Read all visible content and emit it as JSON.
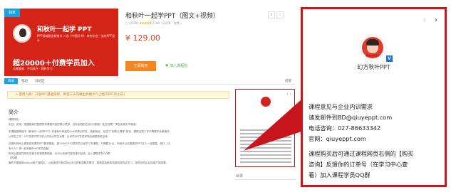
{
  "course": {
    "badge": "独家",
    "cover_brand": "和秋叶一起学 PPT",
    "cover_sub": "PPT领域最佳畅销书 入选《中国好书》 带你学会一流的PPT设计",
    "cover_count": "超20000＋付费学员加入",
    "cover_subcount": "无需基础 · 不用软件 · 随时学习",
    "title": "和秋叶一起学PPT（图文+视频）",
    "meta_prefix": "▢ 25306",
    "stars": "★★★★★",
    "meta_suffix": "2.3W · 好评率 · 收费 ✓",
    "price": "¥ 129.00",
    "buy_label": "立即购买",
    "fav_label": "♥ 加入课程包",
    "icon_share": "⇧",
    "icon_fav": "☆"
  },
  "tabs": {
    "items": [
      "目录",
      "笔记",
      "讨论区"
    ],
    "right": "问答"
  },
  "notice": "⚠ 使用人群：只会PPT基础操作，希望三天内做出高端大气上档次PPT的小白！",
  "intro": {
    "title": "简介",
    "lines": [
      "课程特色：",
      "实战，实用，快捷是我们整理所有课程内容的核心思想，还有全程的在线QQ答疑！还在犹豫？学起来其实不难哦！",
      "",
      "本课程是畅销书《和秋叶一起学PPT》作者秋叶和他的小伙伴原创开发，独家版权，完成了“网易云课堂”首页，跟踪这类工作中需要的全套操作。",
      "让你在工作，PPT变成不同于别人的亮点的艺术感，让你的PPT在任何场合都能惊艳全场。",
      "",
      "这是你的网上课堂的好看的PPT素材模板，超20000个付费学员已经学习本课程，只需要12元，你就可以在图表的PPT达人一起提高，现在，还",
      "有什么？请一起来做8090学员会聚！",
      "购买后直接在网页或者手机端观看视频，也可以给我们留言提问反馈，加入课程学员QQ群。",
      "【答疑】",
      "最终不要使用iphone客户端购买，以免造成付款成功后无法获取课程的情况，推荐直接使用电脑网页购买学习，或网页购买后用客户端观看。"
    ]
  },
  "mini_card_arrows": "‹ ›",
  "side_label": "目录",
  "panel": {
    "arrow_prev": "‹",
    "arrow_next": "›",
    "logo_mark": "秋叶PPT",
    "logo_text": "幻方秋叶PPT",
    "verified": "V",
    "contact_lines": [
      "课程意见与企业内训需求",
      "请发邮件到BD@qiuyeppt.com",
      "电话咨询：027-86633342",
      "官网：qiuyeppt.com"
    ],
    "note_lines": [
      "课程购买后可通过课程网页右侧的【购买",
      "咨询】反馈你的订单号（在学习中心查",
      "看）加入课程学员QQ群"
    ]
  },
  "colors": {
    "accent_red": "#c8151b",
    "price_red": "#e03c1f",
    "buy_orange": "#f5861f",
    "tab_blue": "#1aa1e0"
  }
}
